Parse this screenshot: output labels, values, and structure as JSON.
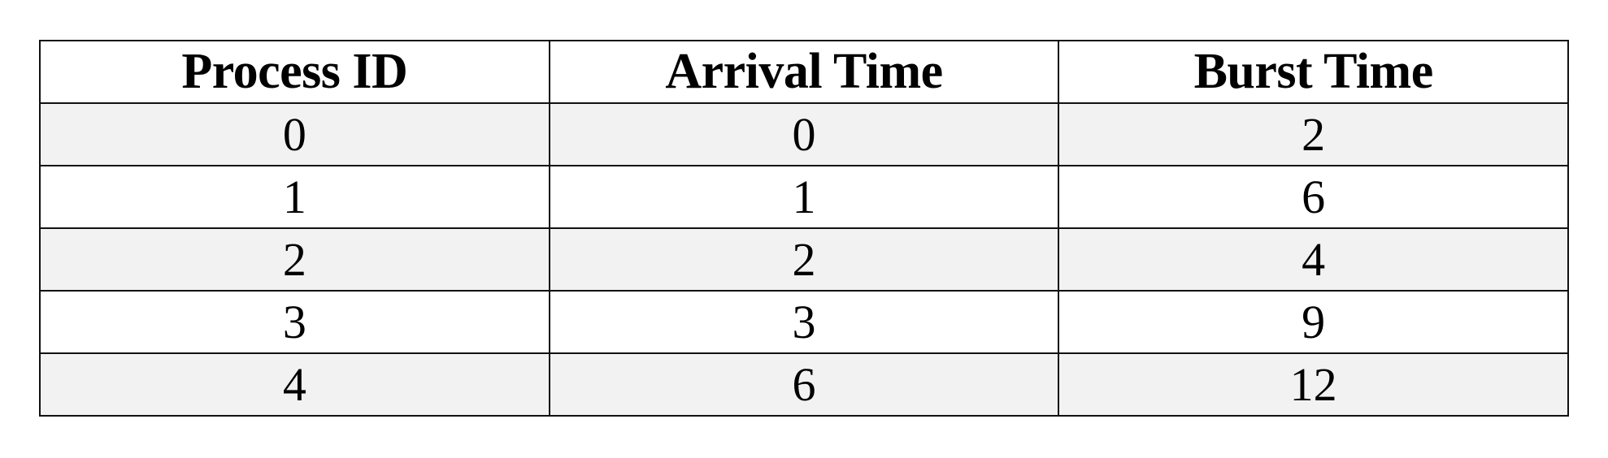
{
  "table": {
    "headers": [
      "Process ID",
      "Arrival Time",
      "Burst Time"
    ],
    "rows": [
      [
        "0",
        "0",
        "2"
      ],
      [
        "1",
        "1",
        "6"
      ],
      [
        "2",
        "2",
        "4"
      ],
      [
        "3",
        "3",
        "9"
      ],
      [
        "4",
        "6",
        "12"
      ]
    ]
  },
  "colors": {
    "shaded_row": "#f2f2f2",
    "plain_row": "#ffffff",
    "border": "#111111"
  }
}
